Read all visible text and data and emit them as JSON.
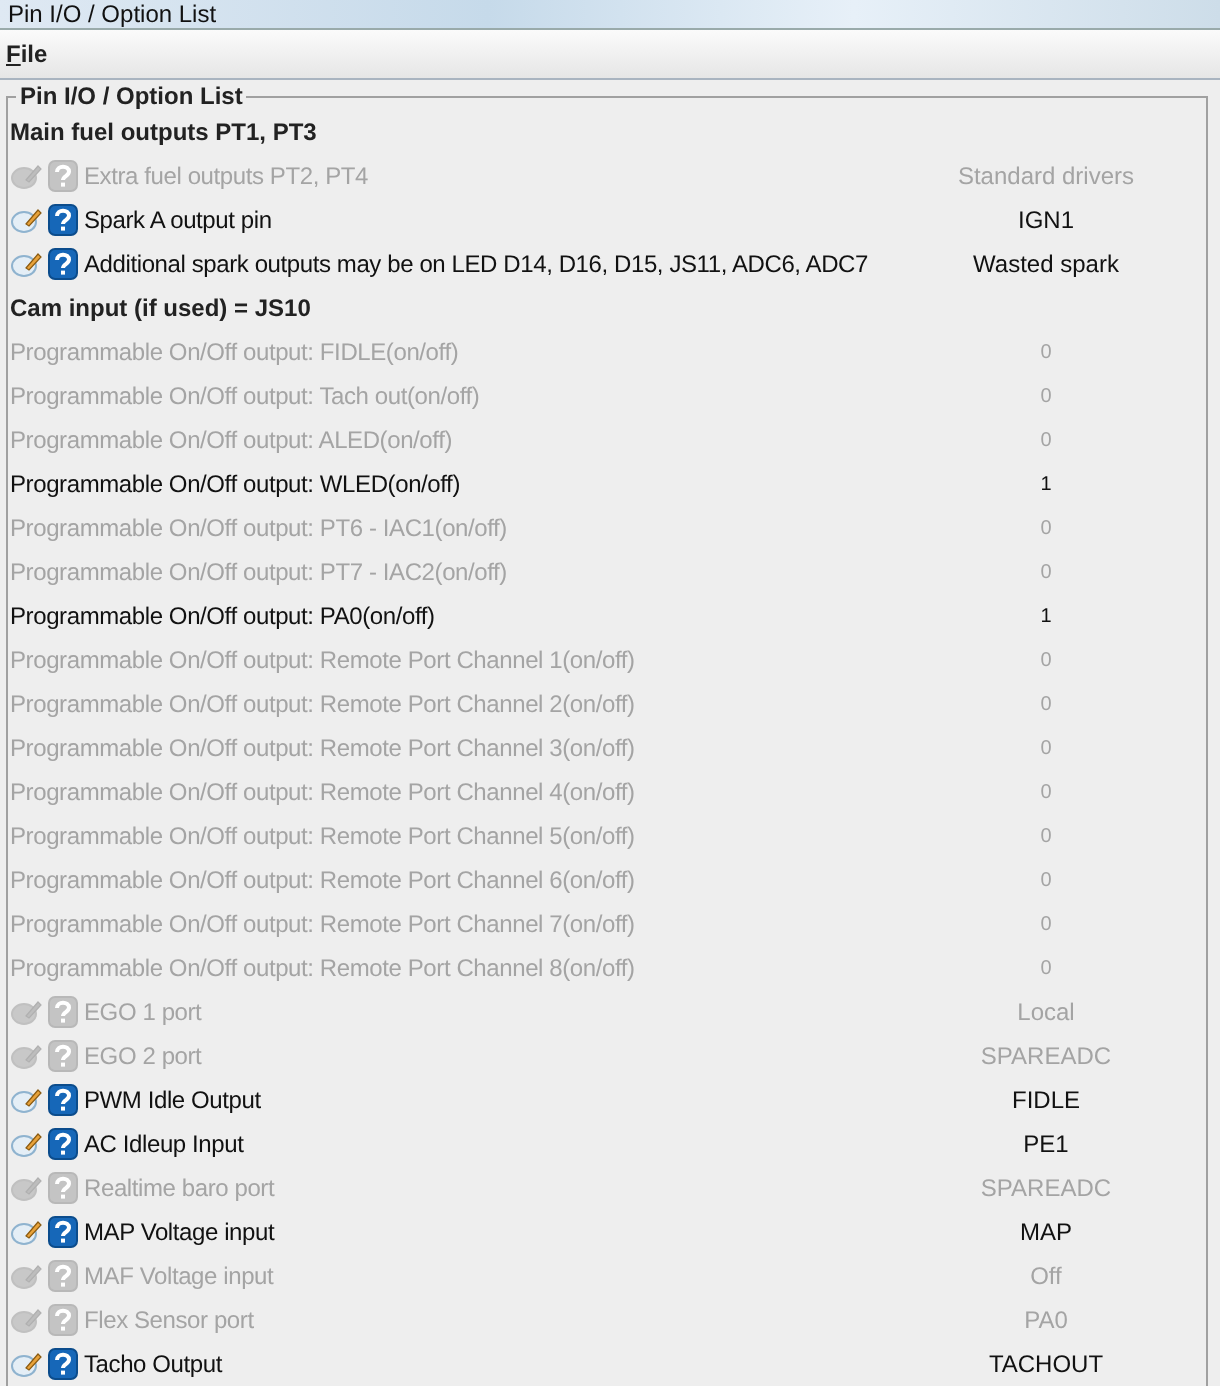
{
  "window": {
    "title": "Pin I/O / Option List"
  },
  "menu": [
    {
      "label": "File"
    }
  ],
  "group": {
    "title": "Pin I/O / Option List"
  },
  "rows": [
    {
      "kind": "heading",
      "label": "Main fuel outputs PT1, PT3"
    },
    {
      "kind": "option",
      "label": "Extra fuel outputs PT2, PT4",
      "value": "Standard drivers",
      "disabled": true
    },
    {
      "kind": "option",
      "label": "Spark A output pin",
      "value": "IGN1",
      "disabled": false
    },
    {
      "kind": "option",
      "label": "Additional spark outputs may be on LED D14, D16, D15, JS11, ADC6, ADC7",
      "value": "Wasted spark",
      "disabled": false
    },
    {
      "kind": "heading",
      "label": "Cam input (if used) = JS10"
    },
    {
      "kind": "toggle",
      "label": "Programmable On/Off output: FIDLE(on/off)",
      "value": "0",
      "disabled": true
    },
    {
      "kind": "toggle",
      "label": "Programmable On/Off output: Tach out(on/off)",
      "value": "0",
      "disabled": true
    },
    {
      "kind": "toggle",
      "label": "Programmable On/Off output: ALED(on/off)",
      "value": "0",
      "disabled": true
    },
    {
      "kind": "toggle",
      "label": "Programmable On/Off output: WLED(on/off)",
      "value": "1",
      "disabled": false
    },
    {
      "kind": "toggle",
      "label": "Programmable On/Off output: PT6 - IAC1(on/off)",
      "value": "0",
      "disabled": true
    },
    {
      "kind": "toggle",
      "label": "Programmable On/Off output: PT7 - IAC2(on/off)",
      "value": "0",
      "disabled": true
    },
    {
      "kind": "toggle",
      "label": "Programmable On/Off output: PA0(on/off)",
      "value": "1",
      "disabled": false
    },
    {
      "kind": "toggle",
      "label": "Programmable On/Off output: Remote Port Channel 1(on/off)",
      "value": "0",
      "disabled": true
    },
    {
      "kind": "toggle",
      "label": "Programmable On/Off output: Remote Port Channel 2(on/off)",
      "value": "0",
      "disabled": true
    },
    {
      "kind": "toggle",
      "label": "Programmable On/Off output: Remote Port Channel 3(on/off)",
      "value": "0",
      "disabled": true
    },
    {
      "kind": "toggle",
      "label": "Programmable On/Off output: Remote Port Channel 4(on/off)",
      "value": "0",
      "disabled": true
    },
    {
      "kind": "toggle",
      "label": "Programmable On/Off output: Remote Port Channel 5(on/off)",
      "value": "0",
      "disabled": true
    },
    {
      "kind": "toggle",
      "label": "Programmable On/Off output: Remote Port Channel 6(on/off)",
      "value": "0",
      "disabled": true
    },
    {
      "kind": "toggle",
      "label": "Programmable On/Off output: Remote Port Channel 7(on/off)",
      "value": "0",
      "disabled": true
    },
    {
      "kind": "toggle",
      "label": "Programmable On/Off output: Remote Port Channel 8(on/off)",
      "value": "0",
      "disabled": true
    },
    {
      "kind": "option",
      "label": "EGO 1 port",
      "value": "Local",
      "disabled": true
    },
    {
      "kind": "option",
      "label": "EGO 2 port",
      "value": "SPAREADC",
      "disabled": true
    },
    {
      "kind": "option",
      "label": "PWM Idle Output",
      "value": "FIDLE",
      "disabled": false
    },
    {
      "kind": "option",
      "label": "AC Idleup Input",
      "value": "PE1",
      "disabled": false
    },
    {
      "kind": "option",
      "label": "Realtime baro port",
      "value": "SPAREADC",
      "disabled": true
    },
    {
      "kind": "option",
      "label": "MAP Voltage input",
      "value": "MAP",
      "disabled": false
    },
    {
      "kind": "option",
      "label": "MAF Voltage input",
      "value": "Off",
      "disabled": true
    },
    {
      "kind": "option",
      "label": "Flex Sensor port",
      "value": "PA0",
      "disabled": true
    },
    {
      "kind": "option",
      "label": "Tacho Output",
      "value": "TACHOUT",
      "disabled": false
    }
  ]
}
